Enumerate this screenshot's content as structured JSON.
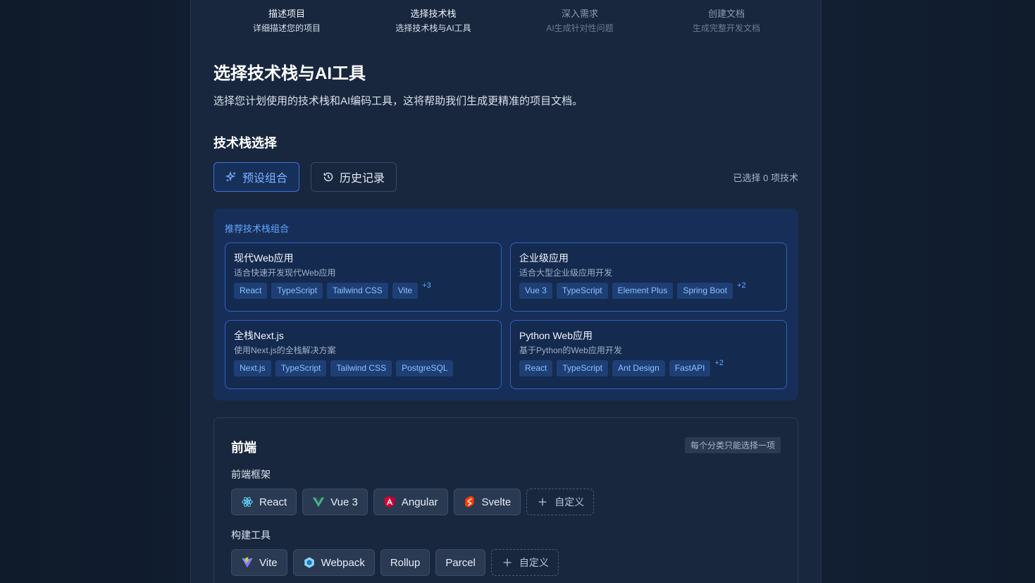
{
  "steps": [
    {
      "title": "描述项目",
      "sub": "详细描述您的项目",
      "state": "done"
    },
    {
      "title": "选择技术栈",
      "sub": "选择技术栈与AI工具",
      "state": "active"
    },
    {
      "title": "深入需求",
      "sub": "AI生成针对性问题",
      "state": "todo"
    },
    {
      "title": "创建文档",
      "sub": "生成完整开发文档",
      "state": "todo"
    }
  ],
  "page": {
    "title": "选择技术栈与AI工具",
    "description": "选择您计划使用的技术栈和AI编码工具，这将帮助我们生成更精准的项目文档。",
    "section_title": "技术栈选择"
  },
  "tabs": {
    "preset_label": "预设组合",
    "history_label": "历史记录"
  },
  "selected_count": "已选择 0 项技术",
  "presets": {
    "title": "推荐技术栈组合",
    "items": [
      {
        "name": "现代Web应用",
        "desc": "适合快速开发现代Web应用",
        "tags": [
          "React",
          "TypeScript",
          "Tailwind CSS",
          "Vite"
        ],
        "more": "+3"
      },
      {
        "name": "企业级应用",
        "desc": "适合大型企业级应用开发",
        "tags": [
          "Vue 3",
          "TypeScript",
          "Element Plus",
          "Spring Boot"
        ],
        "more": "+2"
      },
      {
        "name": "全栈Next.js",
        "desc": "使用Next.js的全栈解决方案",
        "tags": [
          "Next.js",
          "TypeScript",
          "Tailwind CSS",
          "PostgreSQL"
        ],
        "more": ""
      },
      {
        "name": "Python Web应用",
        "desc": "基于Python的Web应用开发",
        "tags": [
          "React",
          "TypeScript",
          "Ant Design",
          "FastAPI"
        ],
        "more": "+2"
      }
    ]
  },
  "frontend": {
    "title": "前端",
    "hint": "每个分类只能选择一项",
    "framework_label": "前端框架",
    "frameworks": [
      {
        "label": "React",
        "icon": "react-icon"
      },
      {
        "label": "Vue 3",
        "icon": "vue-icon"
      },
      {
        "label": "Angular",
        "icon": "angular-icon"
      },
      {
        "label": "Svelte",
        "icon": "svelte-icon"
      }
    ],
    "build_label": "构建工具",
    "build_tools": [
      {
        "label": "Vite",
        "icon": "vite-icon"
      },
      {
        "label": "Webpack",
        "icon": "webpack-icon"
      },
      {
        "label": "Rollup",
        "icon": ""
      },
      {
        "label": "Parcel",
        "icon": ""
      }
    ],
    "custom_label": "自定义"
  },
  "colors": {
    "accent": "#3b73d6",
    "accent_text": "#63a8ff",
    "panel": "#172f58",
    "background": "#18273e"
  }
}
